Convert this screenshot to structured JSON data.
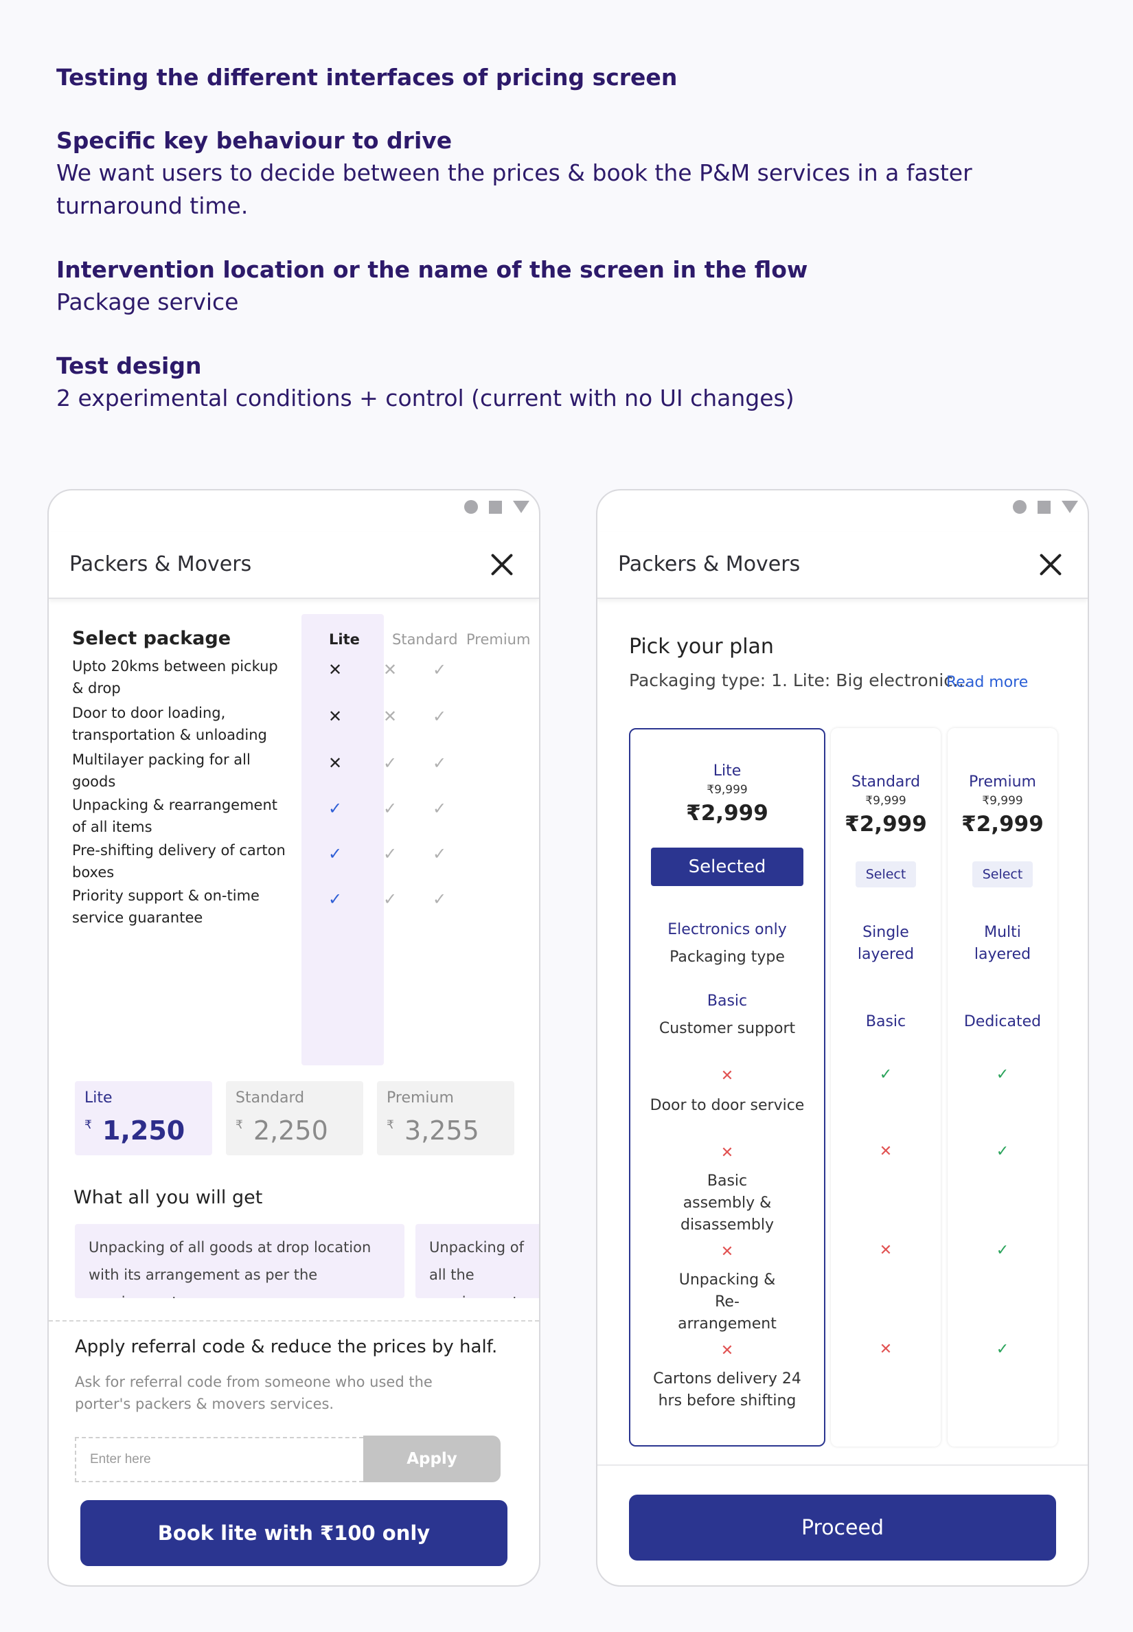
{
  "brief": {
    "q1": "Testing the different interfaces of pricing screen",
    "q2_h": "Specific key behaviour to drive",
    "q2_t": "We want users to decide between the prices & book the P&M services in a faster turnaround time.",
    "q3_h": "Intervention location or the name of the screen in the flow",
    "q3_t": "Package service",
    "q4_h": "Test design",
    "q4_t": "2 experimental conditions + control (current with no UI changes)"
  },
  "phone1": {
    "title": "Packers & Movers",
    "select_package": "Select package",
    "columns": [
      "Lite",
      "Standard",
      "Premium"
    ],
    "features": [
      {
        "label": "Upto 20kms between pickup & drop",
        "lite": "cross",
        "standard": "cross",
        "premium": "check"
      },
      {
        "label": "Door to door loading, transportation & unloading",
        "lite": "cross",
        "standard": "cross",
        "premium": "check"
      },
      {
        "label": "Multilayer packing for all goods",
        "lite": "cross",
        "standard": "check",
        "premium": "check"
      },
      {
        "label": "Unpacking & rearrangement of all items",
        "lite": "check",
        "standard": "check",
        "premium": "check"
      },
      {
        "label": "Pre-shifting delivery of carton boxes",
        "lite": "check",
        "standard": "check",
        "premium": "check"
      },
      {
        "label": "Priority support & on-time service guarantee",
        "lite": "check",
        "standard": "check",
        "premium": "check"
      }
    ],
    "prices": [
      {
        "name": "Lite",
        "currency": "₹",
        "value": "1,250"
      },
      {
        "name": "Standard",
        "currency": "₹",
        "value": "2,250"
      },
      {
        "name": "Premium",
        "currency": "₹",
        "value": "3,255"
      }
    ],
    "what_you_get": "What all you will get",
    "benefits": [
      "Unpacking of all goods at drop location with its arrangement as per the requirement",
      "Unpacking of all the requirement"
    ],
    "referral_title": "Apply referral code & reduce the prices by half.",
    "referral_sub": "Ask for referral code from someone who used the porter's packers & movers services.",
    "referral_placeholder": "Enter here",
    "apply": "Apply",
    "cta": "Book lite with ₹100 only"
  },
  "phone2": {
    "title": "Packers & Movers",
    "pick": "Pick your plan",
    "packaging_type": "Packaging type: 1. Lite: Big electronic...",
    "read_more": "Read more",
    "plans": [
      {
        "name": "Lite",
        "old": "₹9,999",
        "price": "₹2,999",
        "button": "Selected",
        "packaging": "Electronics only",
        "support": "Basic",
        "door": "cross",
        "assembly": "cross",
        "unpacking": "cross",
        "cartons": "cross"
      },
      {
        "name": "Standard",
        "old": "₹9,999",
        "price": "₹2,999",
        "button": "Select",
        "packaging": "Single layered",
        "support": "Basic",
        "door": "check",
        "assembly": "cross",
        "unpacking": "cross",
        "cartons": "cross"
      },
      {
        "name": "Premium",
        "old": "₹9,999",
        "price": "₹2,999",
        "button": "Select",
        "packaging": "Multi layered",
        "support": "Dedicated",
        "door": "check",
        "assembly": "check",
        "unpacking": "check",
        "cartons": "check"
      }
    ],
    "labels": {
      "packaging": "Packaging type",
      "support": "Customer support",
      "door": "Door to door service",
      "assembly": "Basic assembly & disassembly",
      "unpacking": "Unpacking & Re-arrangement",
      "cartons": "Cartons delivery 24 hrs before shifting"
    },
    "proceed": "Proceed"
  },
  "colors": {
    "primary": "#2b3590",
    "accent_bg": "#f3eefb",
    "check_blue": "#2f5fd6",
    "green": "#29a35a",
    "red": "#e15252",
    "heading": "#2d1a6a"
  }
}
